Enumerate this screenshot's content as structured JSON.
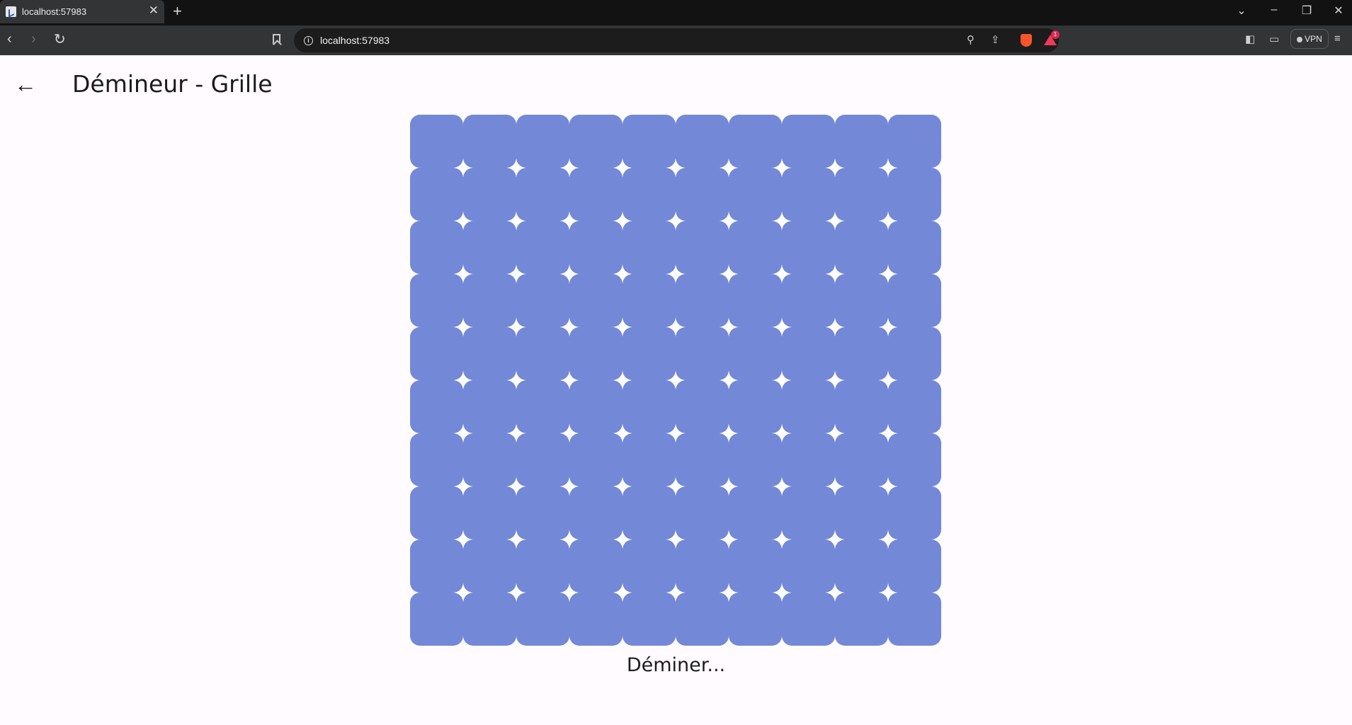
{
  "browser": {
    "tab_title": "localhost:57983",
    "tab_close": "✕",
    "new_tab": "+",
    "url": "localhost:57983",
    "rewards_badge": "1",
    "vpn_label": "VPN"
  },
  "app": {
    "title": "Démineur - Grille",
    "back_icon": "←",
    "status": "Déminer..."
  },
  "grid": {
    "rows": 10,
    "columns": 10,
    "cell_color": "#7388d7",
    "cell_state": "hidden"
  },
  "colors": {
    "tab_bar": "#121212",
    "toolbar": "#323436",
    "page_background": "#fffbfe",
    "cell": "#7388d7"
  }
}
